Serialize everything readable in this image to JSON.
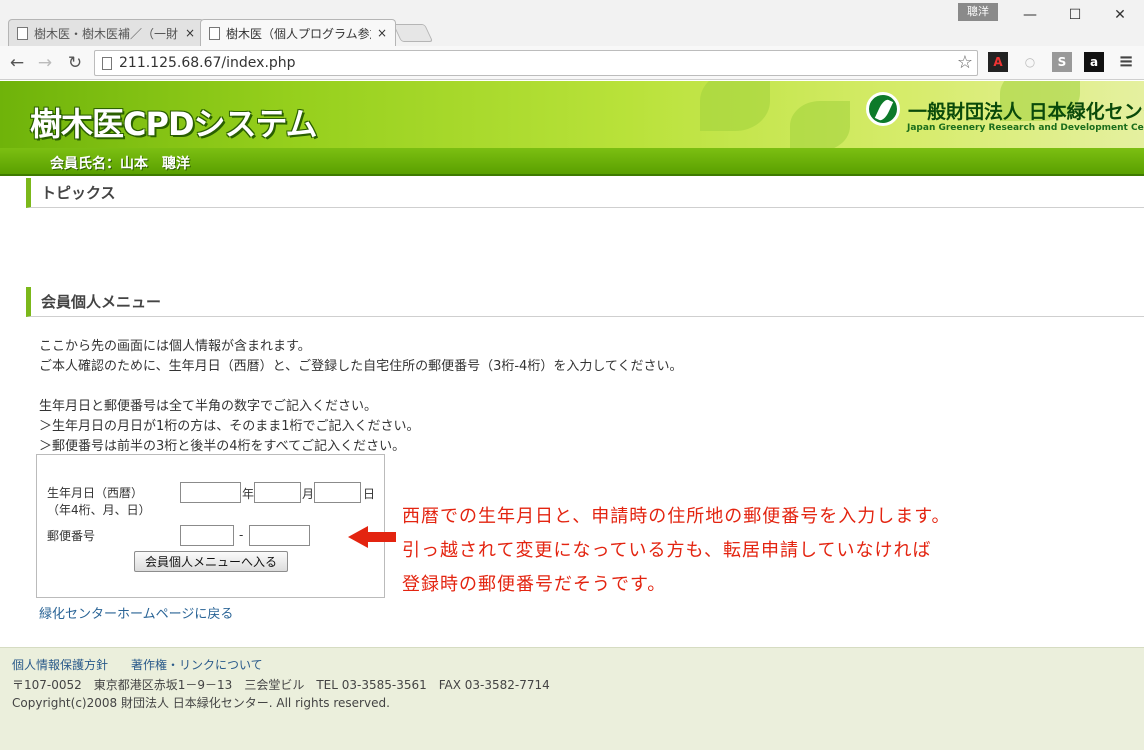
{
  "browser": {
    "tabs": [
      {
        "title": "樹木医・樹木医補／（一財",
        "close": "×"
      },
      {
        "title": "樹木医（個人プログラム参加",
        "close": "×"
      }
    ],
    "user_badge": "聰洋",
    "window_controls": {
      "minimize": "—",
      "maximize": "☐",
      "close": "✕"
    },
    "nav": {
      "back": "←",
      "forward": "→",
      "reload": "↻"
    },
    "url": "211.125.68.67/index.php",
    "star": "☆",
    "menu": "≡"
  },
  "header": {
    "site_title": "樹木医CPDシステム",
    "org_name": "一般財団法人 日本緑化センター",
    "org_name_en": "Japan Greenery Research and Development Center",
    "member_label": "会員氏名：山本　聰洋"
  },
  "topics": {
    "heading": "トピックス"
  },
  "menu_section": {
    "heading": "会員個人メニュー",
    "intro": [
      "ここから先の画面には個人情報が含まれます。",
      "ご本人確認のために、生年月日（西暦）と、ご登録した自宅住所の郵便番号（3桁-4桁）を入力してください。"
    ],
    "notes": [
      "生年月日と郵便番号は全て半角の数字でご記入ください。",
      "＞生年月日の月日が1桁の方は、そのまま1桁でご記入ください。",
      "＞郵便番号は前半の3桁と後半の4桁をすべてご記入ください。"
    ]
  },
  "form": {
    "birth_label": "生年月日（西暦）",
    "birth_sublabel": "（年4桁、月、日）",
    "year_unit": "年",
    "month_unit": "月",
    "day_unit": "日",
    "postal_label": "郵便番号",
    "postal_sep": "-",
    "year_value": "",
    "month_value": "",
    "day_value": "",
    "postal1_value": "",
    "postal2_value": "",
    "submit_label": "会員個人メニューへ入る"
  },
  "home_link": "緑化センターホームページに戻る",
  "annotation": [
    "西暦での生年月日と、申請時の住所地の郵便番号を入力します。",
    "引っ越されて変更になっている方も、転居申請していなければ",
    "登録時の郵便番号だそうです。"
  ],
  "footer": {
    "privacy_link": "個人情報保護方針",
    "copyright_link": "著作権・リンクについて",
    "address": "〒107-0052　東京都港区赤坂1－9－13　三会堂ビル　TEL 03-3585-3561　FAX 03-3582-7714",
    "copyright": "Copyright(c)2008 財団法人 日本緑化センター. All rights reserved."
  },
  "colors": {
    "header_green": "#7bb81a",
    "annotation_red": "#e32410",
    "link_blue": "#2a6496"
  }
}
